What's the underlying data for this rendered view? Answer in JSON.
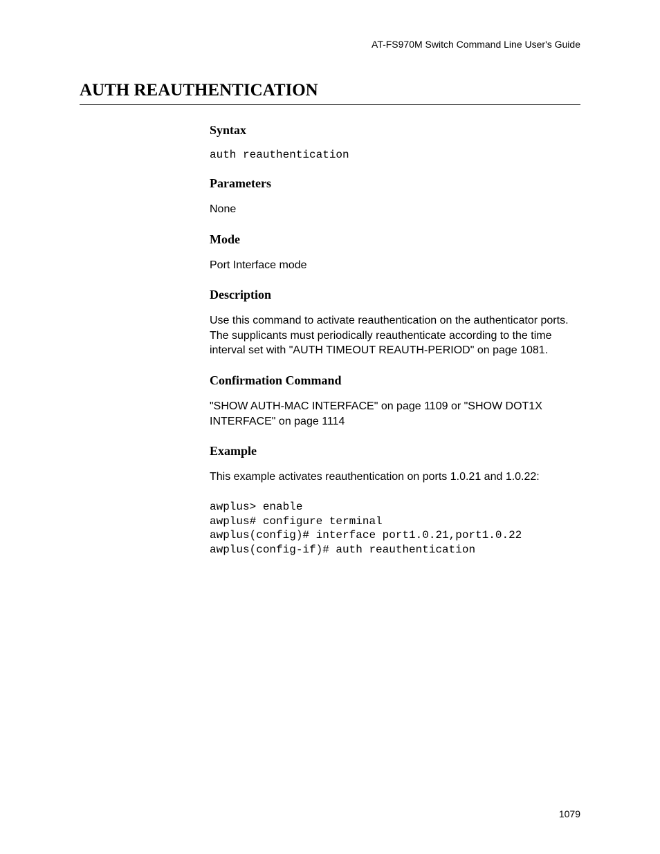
{
  "header": {
    "guide_title": "AT-FS970M Switch Command Line User's Guide"
  },
  "title": "AUTH REAUTHENTICATION",
  "sections": {
    "syntax": {
      "heading": "Syntax",
      "content": "auth reauthentication"
    },
    "parameters": {
      "heading": "Parameters",
      "content": "None"
    },
    "mode": {
      "heading": "Mode",
      "content": "Port Interface mode"
    },
    "description": {
      "heading": "Description",
      "content": "Use this command to activate reauthentication on the authenticator ports. The supplicants must periodically reauthenticate according to the time interval set with \"AUTH TIMEOUT REAUTH-PERIOD\" on page 1081."
    },
    "confirmation": {
      "heading": "Confirmation Command",
      "content": "\"SHOW AUTH-MAC INTERFACE\" on page 1109 or \"SHOW DOT1X INTERFACE\" on page 1114"
    },
    "example": {
      "heading": "Example",
      "intro": "This example activates reauthentication on ports 1.0.21 and 1.0.22:",
      "code": "awplus> enable\nawplus# configure terminal\nawplus(config)# interface port1.0.21,port1.0.22\nawplus(config-if)# auth reauthentication"
    }
  },
  "page_number": "1079"
}
